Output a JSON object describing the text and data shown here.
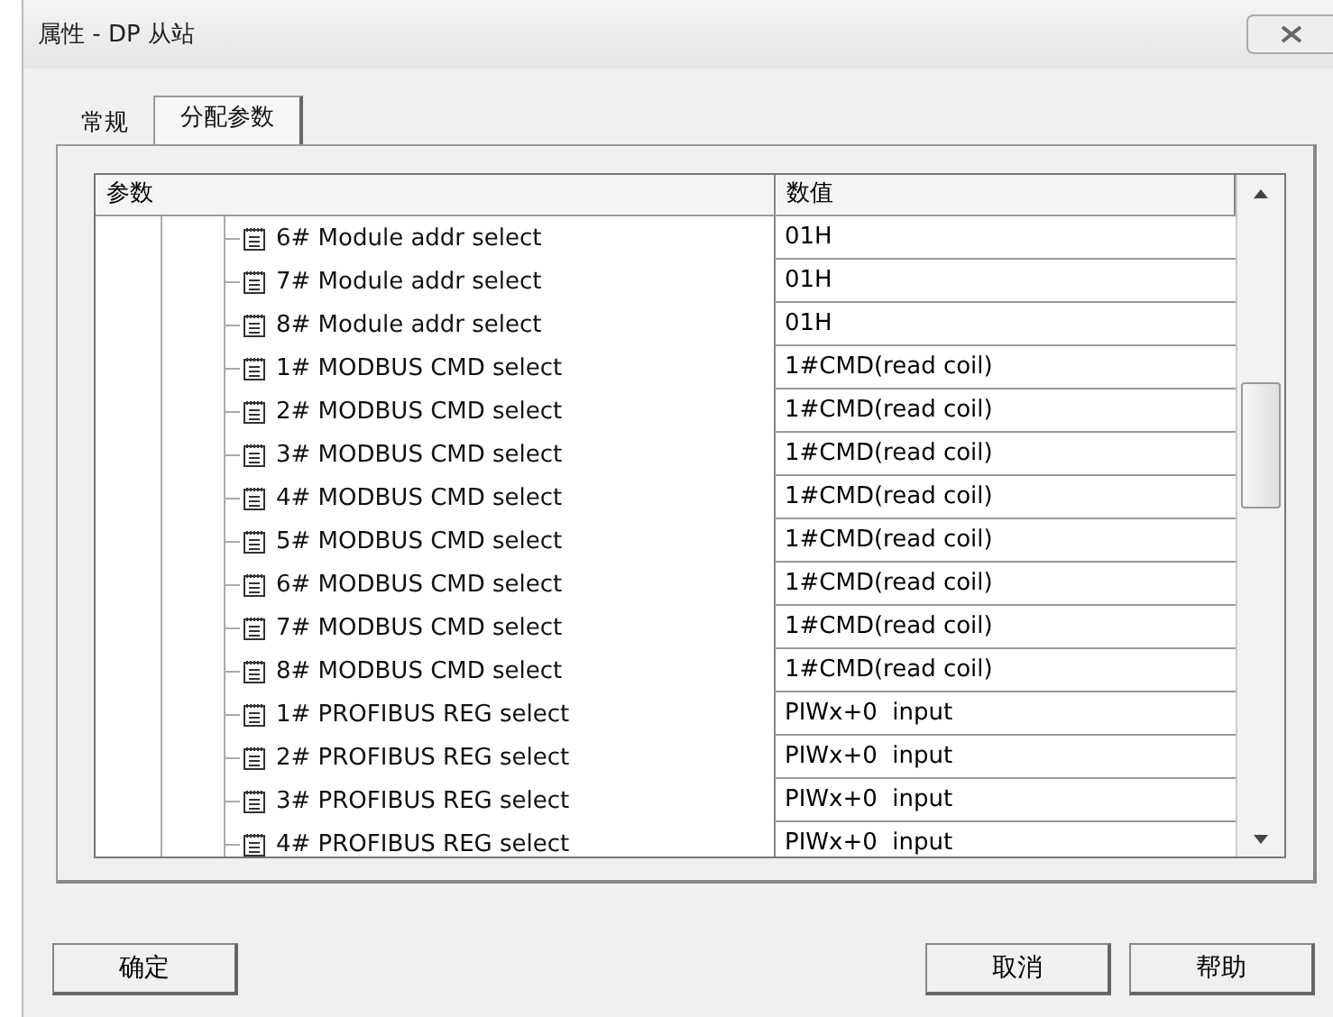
{
  "window": {
    "title": "属性 - DP 从站"
  },
  "tabs": [
    {
      "label": "常规",
      "selected": false
    },
    {
      "label": "分配参数",
      "selected": true
    }
  ],
  "table": {
    "columns": [
      "参数",
      "数值"
    ],
    "rows": [
      {
        "name": "6# Module addr select",
        "value": "01H"
      },
      {
        "name": "7# Module addr select",
        "value": "01H"
      },
      {
        "name": "8# Module addr select",
        "value": "01H"
      },
      {
        "name": "1# MODBUS CMD select",
        "value": "1#CMD(read coil)"
      },
      {
        "name": "2# MODBUS CMD select",
        "value": "1#CMD(read coil)"
      },
      {
        "name": "3# MODBUS CMD select",
        "value": "1#CMD(read coil)"
      },
      {
        "name": "4# MODBUS CMD select",
        "value": "1#CMD(read coil)"
      },
      {
        "name": "5# MODBUS CMD select",
        "value": "1#CMD(read coil)"
      },
      {
        "name": "6# MODBUS CMD select",
        "value": "1#CMD(read coil)"
      },
      {
        "name": "7# MODBUS CMD select",
        "value": "1#CMD(read coil)"
      },
      {
        "name": "8# MODBUS CMD select",
        "value": "1#CMD(read coil)"
      },
      {
        "name": "1# PROFIBUS REG select",
        "value": "PIWx+0  input"
      },
      {
        "name": "2# PROFIBUS REG select",
        "value": "PIWx+0  input"
      },
      {
        "name": "3# PROFIBUS REG select",
        "value": "PIWx+0  input"
      },
      {
        "name": "4# PROFIBUS REG select",
        "value": "PIWx+0  input"
      }
    ]
  },
  "buttons": [
    {
      "label": "确定"
    },
    {
      "label": "取消"
    },
    {
      "label": "帮助"
    }
  ]
}
